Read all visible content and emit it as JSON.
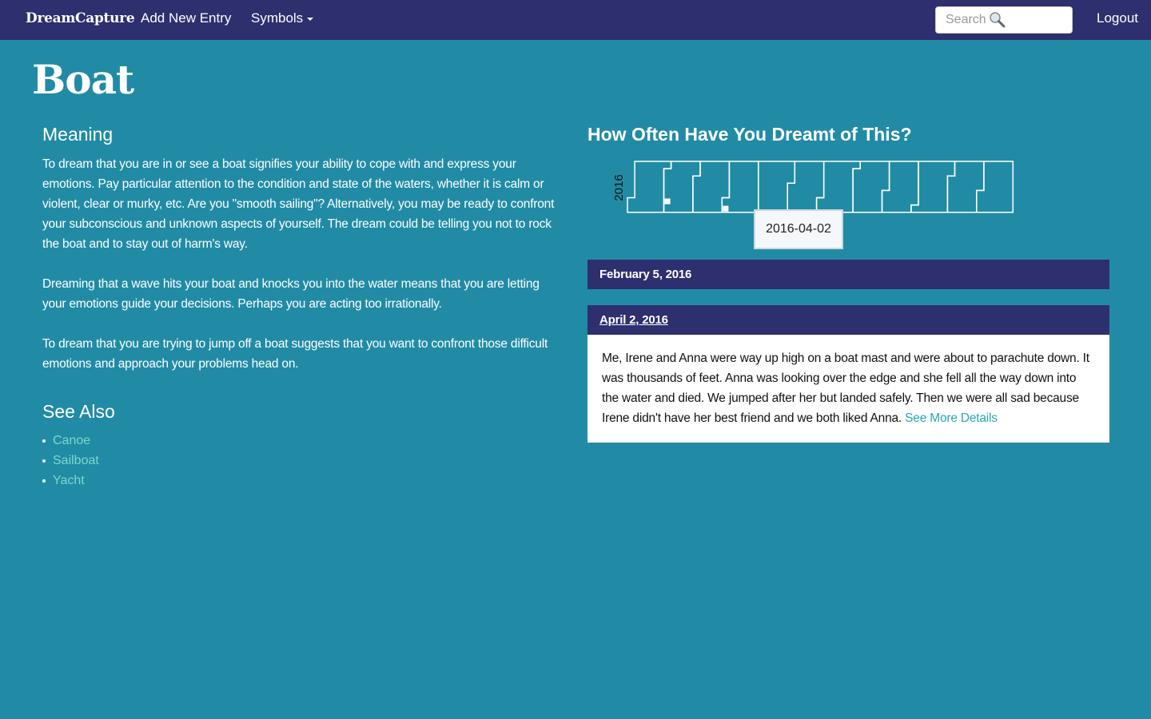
{
  "nav": {
    "brand": "DreamCapture",
    "add_entry": "Add New Entry",
    "symbols": "Symbols",
    "search_placeholder": "Search",
    "logout": "Logout"
  },
  "page": {
    "title": "Boat"
  },
  "meaning": {
    "heading": "Meaning",
    "paragraphs": [
      "To dream that you are in or see a boat signifies your ability to cope with and express your emotions. Pay particular attention to the condition and state of the waters, whether it is calm or violent, clear or murky, etc. Are you \"smooth sailing\"? Alternatively, you may be ready to confront your subconscious and unknown aspects of yourself. The dream could be telling you not to rock the boat and to stay out of harm's way.",
      "Dreaming that a wave hits your boat and knocks you into the water means that you are letting your emotions guide your decisions. Perhaps you are acting too irrationally.",
      "To dream that you are trying to jump off a boat suggests that  you want to confront those difficult emotions and approach your  problems head on."
    ]
  },
  "see_also": {
    "heading": "See Also",
    "items": [
      "Canoe",
      "Sailboat",
      "Yacht"
    ]
  },
  "frequency": {
    "heading": "How Often Have You Dreamt of This?",
    "year_label": "2016",
    "tooltip": "2016-04-02",
    "highlighted_dates": [
      "2016-02-05",
      "2016-04-02"
    ]
  },
  "entries": [
    {
      "date": "February 5, 2016"
    },
    {
      "date": "April 2, 2016",
      "text": "Me, Irene and Anna were way up high on a boat mast and were about to parachute down. It was thousands of feet. Anna was looking over the edge and she fell all the way down into the water and died. We jumped after her but landed safely. Then we were all sad because Irene didn't have her best friend and we both liked Anna.",
      "link": "See More Details"
    }
  ],
  "colors": {
    "background": "#218ba5",
    "navbar": "#2e2f6e",
    "link": "#7fd6cb",
    "see_more": "#27a7b5"
  },
  "icons": {
    "search": "magnifier-icon",
    "dropdown": "caret-down-icon"
  }
}
